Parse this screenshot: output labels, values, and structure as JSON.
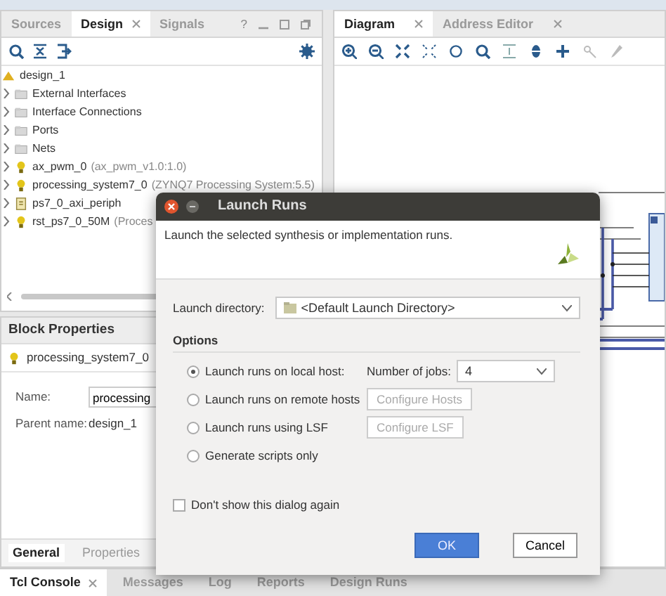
{
  "left_panel": {
    "tabs": [
      {
        "label": "Sources",
        "selected": false,
        "closable": false
      },
      {
        "label": "Design",
        "selected": true,
        "closable": true
      },
      {
        "label": "Signals",
        "selected": false,
        "closable": false
      }
    ],
    "help": "?",
    "tree": {
      "label": "design_1",
      "children": [
        {
          "label": "External Interfaces",
          "kind": "folder",
          "expanded": false
        },
        {
          "label": "Interface Connections",
          "kind": "folder",
          "expanded": false
        },
        {
          "label": "Ports",
          "kind": "folder",
          "expanded": false
        },
        {
          "label": "Nets",
          "kind": "folder",
          "expanded": false
        },
        {
          "label": "ax_pwm_0",
          "detail": "(ax_pwm_v1.0:1.0)",
          "kind": "ip",
          "expanded": false
        },
        {
          "label": "processing_system7_0",
          "detail": "(ZYNQ7 Processing System:5.5)",
          "kind": "ip",
          "expanded": false
        },
        {
          "label": "ps7_0_axi_periph",
          "kind": "hier",
          "expanded": false
        },
        {
          "label": "rst_ps7_0_50M",
          "detail": "(Proces",
          "kind": "ip",
          "expanded": false
        }
      ]
    }
  },
  "block_properties": {
    "title": "Block Properties",
    "object": "processing_system7_0",
    "fields": [
      {
        "label": "Name:",
        "value": "processing",
        "kind": "input"
      },
      {
        "label": "Parent name:",
        "value": "design_1",
        "kind": "text"
      }
    ],
    "tabs": [
      {
        "label": "General",
        "selected": true
      },
      {
        "label": "Properties",
        "selected": false
      }
    ]
  },
  "right_panel": {
    "tabs": [
      {
        "label": "Diagram",
        "selected": true,
        "closable": true
      },
      {
        "label": "Address Editor",
        "selected": false,
        "closable": true
      }
    ]
  },
  "bottom_tabs": [
    {
      "label": "Tcl Console",
      "selected": true,
      "closable": true
    },
    {
      "label": "Messages",
      "selected": false,
      "closable": false
    },
    {
      "label": "Log",
      "selected": false,
      "closable": false
    },
    {
      "label": "Reports",
      "selected": false,
      "closable": false
    },
    {
      "label": "Design Runs",
      "selected": false,
      "closable": false
    }
  ],
  "dialog": {
    "title": "Launch Runs",
    "description": "Launch the selected synthesis or implementation runs.",
    "directory_label": "Launch directory:",
    "directory": "<Default Launch Directory>",
    "options_title": "Options",
    "options": [
      {
        "label": "Launch runs on local host:",
        "selected": true,
        "extra": {
          "kind": "jobs",
          "label": "Number of jobs:",
          "value": "4"
        }
      },
      {
        "label": "Launch runs on remote hosts",
        "selected": false,
        "extra": {
          "kind": "button",
          "label": "Configure Hosts",
          "disabled": true
        }
      },
      {
        "label": "Launch runs using LSF",
        "selected": false,
        "extra": {
          "kind": "button",
          "label": "Configure LSF",
          "disabled": true
        }
      },
      {
        "label": "Generate scripts only",
        "selected": false
      }
    ],
    "dont_show": {
      "label": "Don't show this dialog again",
      "checked": false
    },
    "buttons": [
      {
        "label": "OK",
        "kind": "primary"
      },
      {
        "label": "Cancel",
        "kind": "default"
      }
    ]
  }
}
